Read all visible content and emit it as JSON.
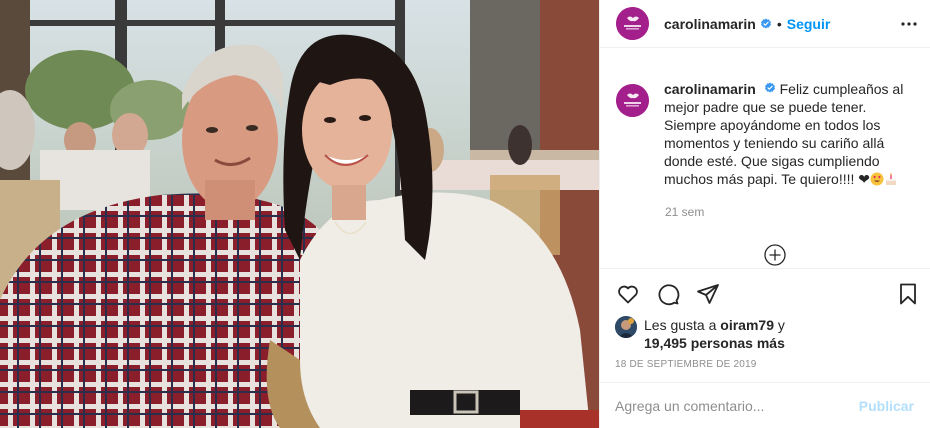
{
  "post": {
    "photo_alt": "",
    "avatar_text": "CAROLINA MARIN"
  },
  "header": {
    "username": "carolinamarin",
    "separator": "•",
    "follow_label": "Seguir",
    "more_icon": "more-horizontal-icon",
    "verified_icon": "verified-badge-icon"
  },
  "caption": {
    "username": "carolinamarin",
    "text": "Feliz cumpleaños al mejor padre que se puede tener. Siempre apoyándome en todos los momentos y teniendo su cariño allá donde esté. Que sigas cumpliendo muchos más papi. Te quiero!!!! ❤",
    "emojis": [
      "heart-eyes-emoji",
      "birthday-cake-emoji"
    ],
    "time_ago": "21 sem"
  },
  "actions": {
    "like_icon": "heart-icon",
    "comment_icon": "comment-icon",
    "share_icon": "paper-plane-icon",
    "save_icon": "bookmark-icon",
    "load_more_icon": "plus-circle-icon"
  },
  "likes": {
    "prefix": "Les gusta a ",
    "user": "oiram79",
    "joiner": " y",
    "count": "19,495 personas más"
  },
  "date": "18 DE SEPTIEMBRE DE 2019",
  "comment": {
    "placeholder": "Agrega un comentario...",
    "publish_label": "Publicar"
  },
  "colors": {
    "accent": "#0095f6",
    "avatar_bg": "#a3208c",
    "muted": "#8e8e8e",
    "publish_disabled": "#b2dffc"
  }
}
